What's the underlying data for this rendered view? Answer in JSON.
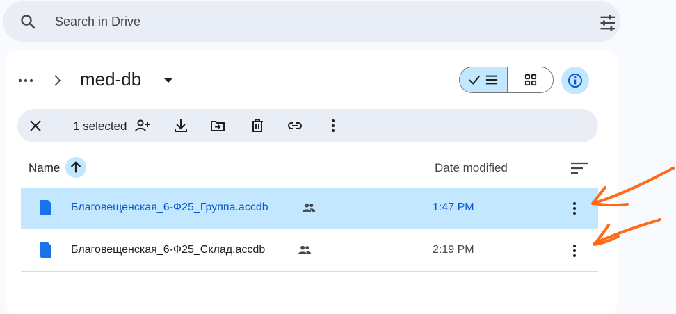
{
  "search": {
    "placeholder": "Search in Drive"
  },
  "breadcrumb": {
    "current_folder": "med-db"
  },
  "selection_bar": {
    "count_label": "1 selected"
  },
  "list_header": {
    "name": "Name",
    "date_modified": "Date modified"
  },
  "files": [
    {
      "name": "Благовещенская_6-Ф25_Группа.accdb",
      "modified": "1:47 PM",
      "shared": true,
      "selected": true
    },
    {
      "name": "Благовещенская_6-Ф25_Склад.accdb",
      "modified": "2:19 PM",
      "shared": true,
      "selected": false
    }
  ],
  "colors": {
    "accent": "#0b57d0",
    "selection": "#c2e7ff",
    "annotation": "#ff6a13",
    "file_icon": "#1a73e8"
  }
}
